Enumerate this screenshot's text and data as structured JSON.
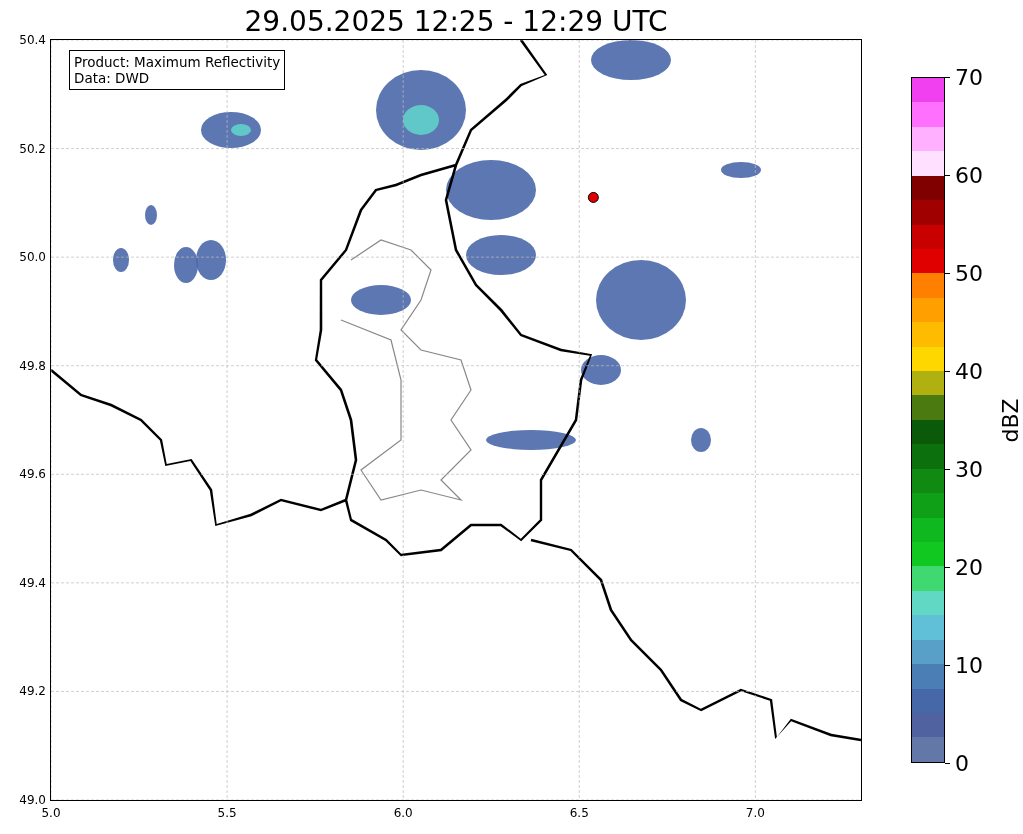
{
  "title": "29.05.2025 12:25 - 12:29 UTC",
  "info_box": [
    "Product: Maximum Reflectivity",
    "Data: DWD"
  ],
  "chart_data": {
    "type": "scatter",
    "x": [
      6.54
    ],
    "values": [
      50.11
    ],
    "grid": true,
    "xlim": [
      5.0,
      7.3
    ],
    "ylim": [
      49.0,
      50.4
    ],
    "xticks": [
      {
        "value": 5.0,
        "label": "5.0"
      },
      {
        "value": 5.5,
        "label": "5.5"
      },
      {
        "value": 6.0,
        "label": "6.0"
      },
      {
        "value": 6.5,
        "label": "6.5"
      },
      {
        "value": 7.0,
        "label": "7.0"
      }
    ],
    "yticks": [
      {
        "value": 49.0,
        "label": "49.0"
      },
      {
        "value": 49.2,
        "label": "49.2"
      },
      {
        "value": 49.4,
        "label": "49.4"
      },
      {
        "value": 49.6,
        "label": "49.6"
      },
      {
        "value": 49.8,
        "label": "49.8"
      },
      {
        "value": 50.0,
        "label": "50.0"
      },
      {
        "value": 50.2,
        "label": "50.2"
      },
      {
        "value": 50.4,
        "label": "50.4"
      }
    ]
  },
  "colorbar": {
    "label": "dBZ",
    "ticks": [
      "70",
      "60",
      "50",
      "40",
      "30",
      "20",
      "10",
      "0"
    ],
    "segments": [
      {
        "color": "#f040f0"
      },
      {
        "color": "#ff70ff"
      },
      {
        "color": "#ffb0ff"
      },
      {
        "color": "#ffe0ff"
      },
      {
        "color": "#800000"
      },
      {
        "color": "#a00000"
      },
      {
        "color": "#c80000"
      },
      {
        "color": "#e00000"
      },
      {
        "color": "#ff8000"
      },
      {
        "color": "#ffa000"
      },
      {
        "color": "#ffbb00"
      },
      {
        "color": "#ffd700"
      },
      {
        "color": "#b0b010"
      },
      {
        "color": "#4a7a10"
      },
      {
        "color": "#0a5a0a"
      },
      {
        "color": "#0c700c"
      },
      {
        "color": "#108a10"
      },
      {
        "color": "#10a018"
      },
      {
        "color": "#10b820"
      },
      {
        "color": "#10c820"
      },
      {
        "color": "#40d870"
      },
      {
        "color": "#60d8c4"
      },
      {
        "color": "#60c0d8"
      },
      {
        "color": "#58a0c8"
      },
      {
        "color": "#4a7eb4"
      },
      {
        "color": "#4668a8"
      },
      {
        "color": "#5062a0"
      },
      {
        "color": "#6478a8"
      }
    ]
  }
}
